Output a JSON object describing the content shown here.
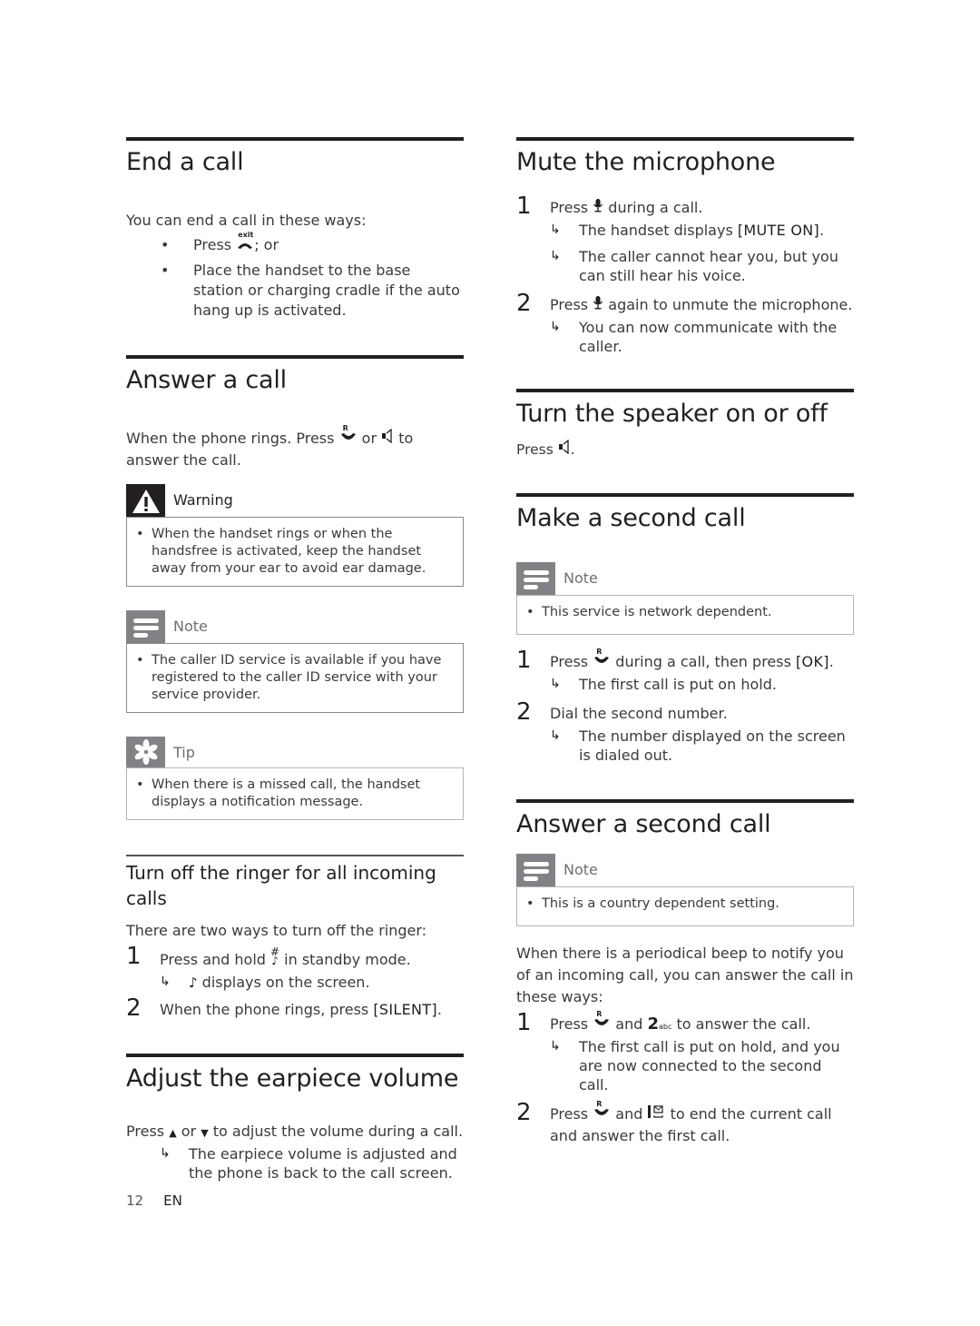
{
  "left": {
    "end_call": {
      "title": "End a call",
      "intro": "You can end a call in these ways:",
      "bullets": [
        {
          "pre": "Press ",
          "icon": "exit-key-icon",
          "icon_sup": "exit",
          "post": "; or"
        },
        {
          "text": "Place the handset to the base station or charging cradle if the auto hang up is activated."
        }
      ]
    },
    "answer_call": {
      "title": "Answer a call",
      "body_pre": "When the phone rings. Press ",
      "body_mid": " or ",
      "body_post": " to answer the call.",
      "warning": {
        "label": "Warning",
        "items": [
          "When the handset rings or when the handsfree is activated, keep the handset away from your ear to avoid ear damage."
        ]
      },
      "note": {
        "label": "Note",
        "items": [
          "The caller ID service is available if you have registered to the caller ID service with your service provider."
        ]
      },
      "tip": {
        "label": "Tip",
        "items": [
          "When there is a missed call, the handset displays a notification message."
        ]
      }
    },
    "ringer": {
      "title": "Turn off the ringer for all incoming calls",
      "intro": "There are two ways to turn off the ringer:",
      "steps": [
        {
          "num": "1",
          "pre": "Press and hold ",
          "post": " in standby mode.",
          "result": " displays on the screen."
        },
        {
          "num": "2",
          "pre": "When the phone rings, press ",
          "bold": "[SILENT]",
          "post": "."
        }
      ]
    },
    "volume": {
      "title": "Adjust the earpiece volume",
      "body_pre": "Press ",
      "body_mid": " or ",
      "body_post": " to adjust the volume during a call.",
      "result": "The earpiece volume is adjusted and the phone is back to the call screen."
    }
  },
  "right": {
    "mute": {
      "title": "Mute the microphone",
      "steps": [
        {
          "num": "1",
          "pre": "Press ",
          "post": " during a call.",
          "results": [
            {
              "pre": "The handset displays ",
              "bold": "[MUTE ON]",
              "post": "."
            },
            {
              "pre": "The caller cannot hear you, but you can still hear his voice."
            }
          ]
        },
        {
          "num": "2",
          "pre": "Press ",
          "post": " again to unmute the microphone.",
          "results": [
            {
              "pre": "You can now communicate with the caller."
            }
          ]
        }
      ]
    },
    "speaker": {
      "title": "Turn the speaker on or off",
      "body_pre": "Press ",
      "body_post": "."
    },
    "second_call": {
      "title": "Make a second call",
      "note": {
        "label": "Note",
        "items": [
          "This service is network dependent."
        ]
      },
      "steps": [
        {
          "num": "1",
          "pre": "Press ",
          "post": " during a call, then press ",
          "bold": "[OK]",
          "post2": ".",
          "result": "The first call is put on hold."
        },
        {
          "num": "2",
          "pre": "Dial the second number.",
          "result": "The number displayed on the screen is dialed out."
        }
      ]
    },
    "answer_second": {
      "title": "Answer a second call",
      "note": {
        "label": "Note",
        "items": [
          "This is a country dependent setting."
        ]
      },
      "intro": "When there is a periodical beep to notify you of an incoming call, you can answer the call in these ways:",
      "steps": [
        {
          "num": "1",
          "pre": "Press ",
          "mid": " and ",
          "key": "2",
          "key_sub": "abc",
          "post": " to answer the call.",
          "result": "The first call is put on hold, and you are now connected to the second call."
        },
        {
          "num": "2",
          "pre": "Press ",
          "mid": " and ",
          "post": " to end the current call and answer the first call."
        }
      ]
    }
  },
  "footer": {
    "page": "12",
    "lang": "EN"
  },
  "icons": {
    "r_key_sup": "R",
    "arrow": "↳"
  }
}
